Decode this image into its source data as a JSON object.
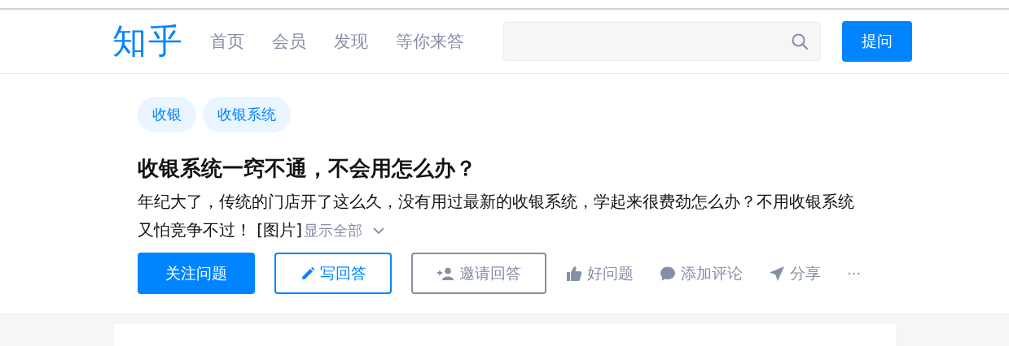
{
  "header": {
    "logo": "知乎",
    "nav": [
      {
        "label": "首页",
        "selected": false
      },
      {
        "label": "会员",
        "selected": false
      },
      {
        "label": "发现",
        "selected": false
      },
      {
        "label": "等你来答",
        "selected": false
      }
    ],
    "ask_button": "提问"
  },
  "question": {
    "topics": [
      "收银",
      "收银系统"
    ],
    "title": "收银系统一窍不通，不会用怎么办？",
    "description_lines": [
      "年纪大了，传统的门店开了这么久，没有用过最新的收银系统，学起来很费劲怎么办？不用收银系统",
      "又怕竞争不过！ [图片]"
    ],
    "show_all": "显示全部",
    "actions": [
      {
        "kind": "primary",
        "label": "关注问题"
      },
      {
        "kind": "outline",
        "label": "写回答"
      },
      {
        "kind": "outline-gray",
        "label": "邀请回答"
      },
      {
        "kind": "plain",
        "label": "好问题"
      },
      {
        "kind": "plain",
        "label": "添加评论"
      },
      {
        "kind": "plain",
        "label": "分享"
      },
      {
        "kind": "more",
        "label": "···"
      }
    ]
  }
}
